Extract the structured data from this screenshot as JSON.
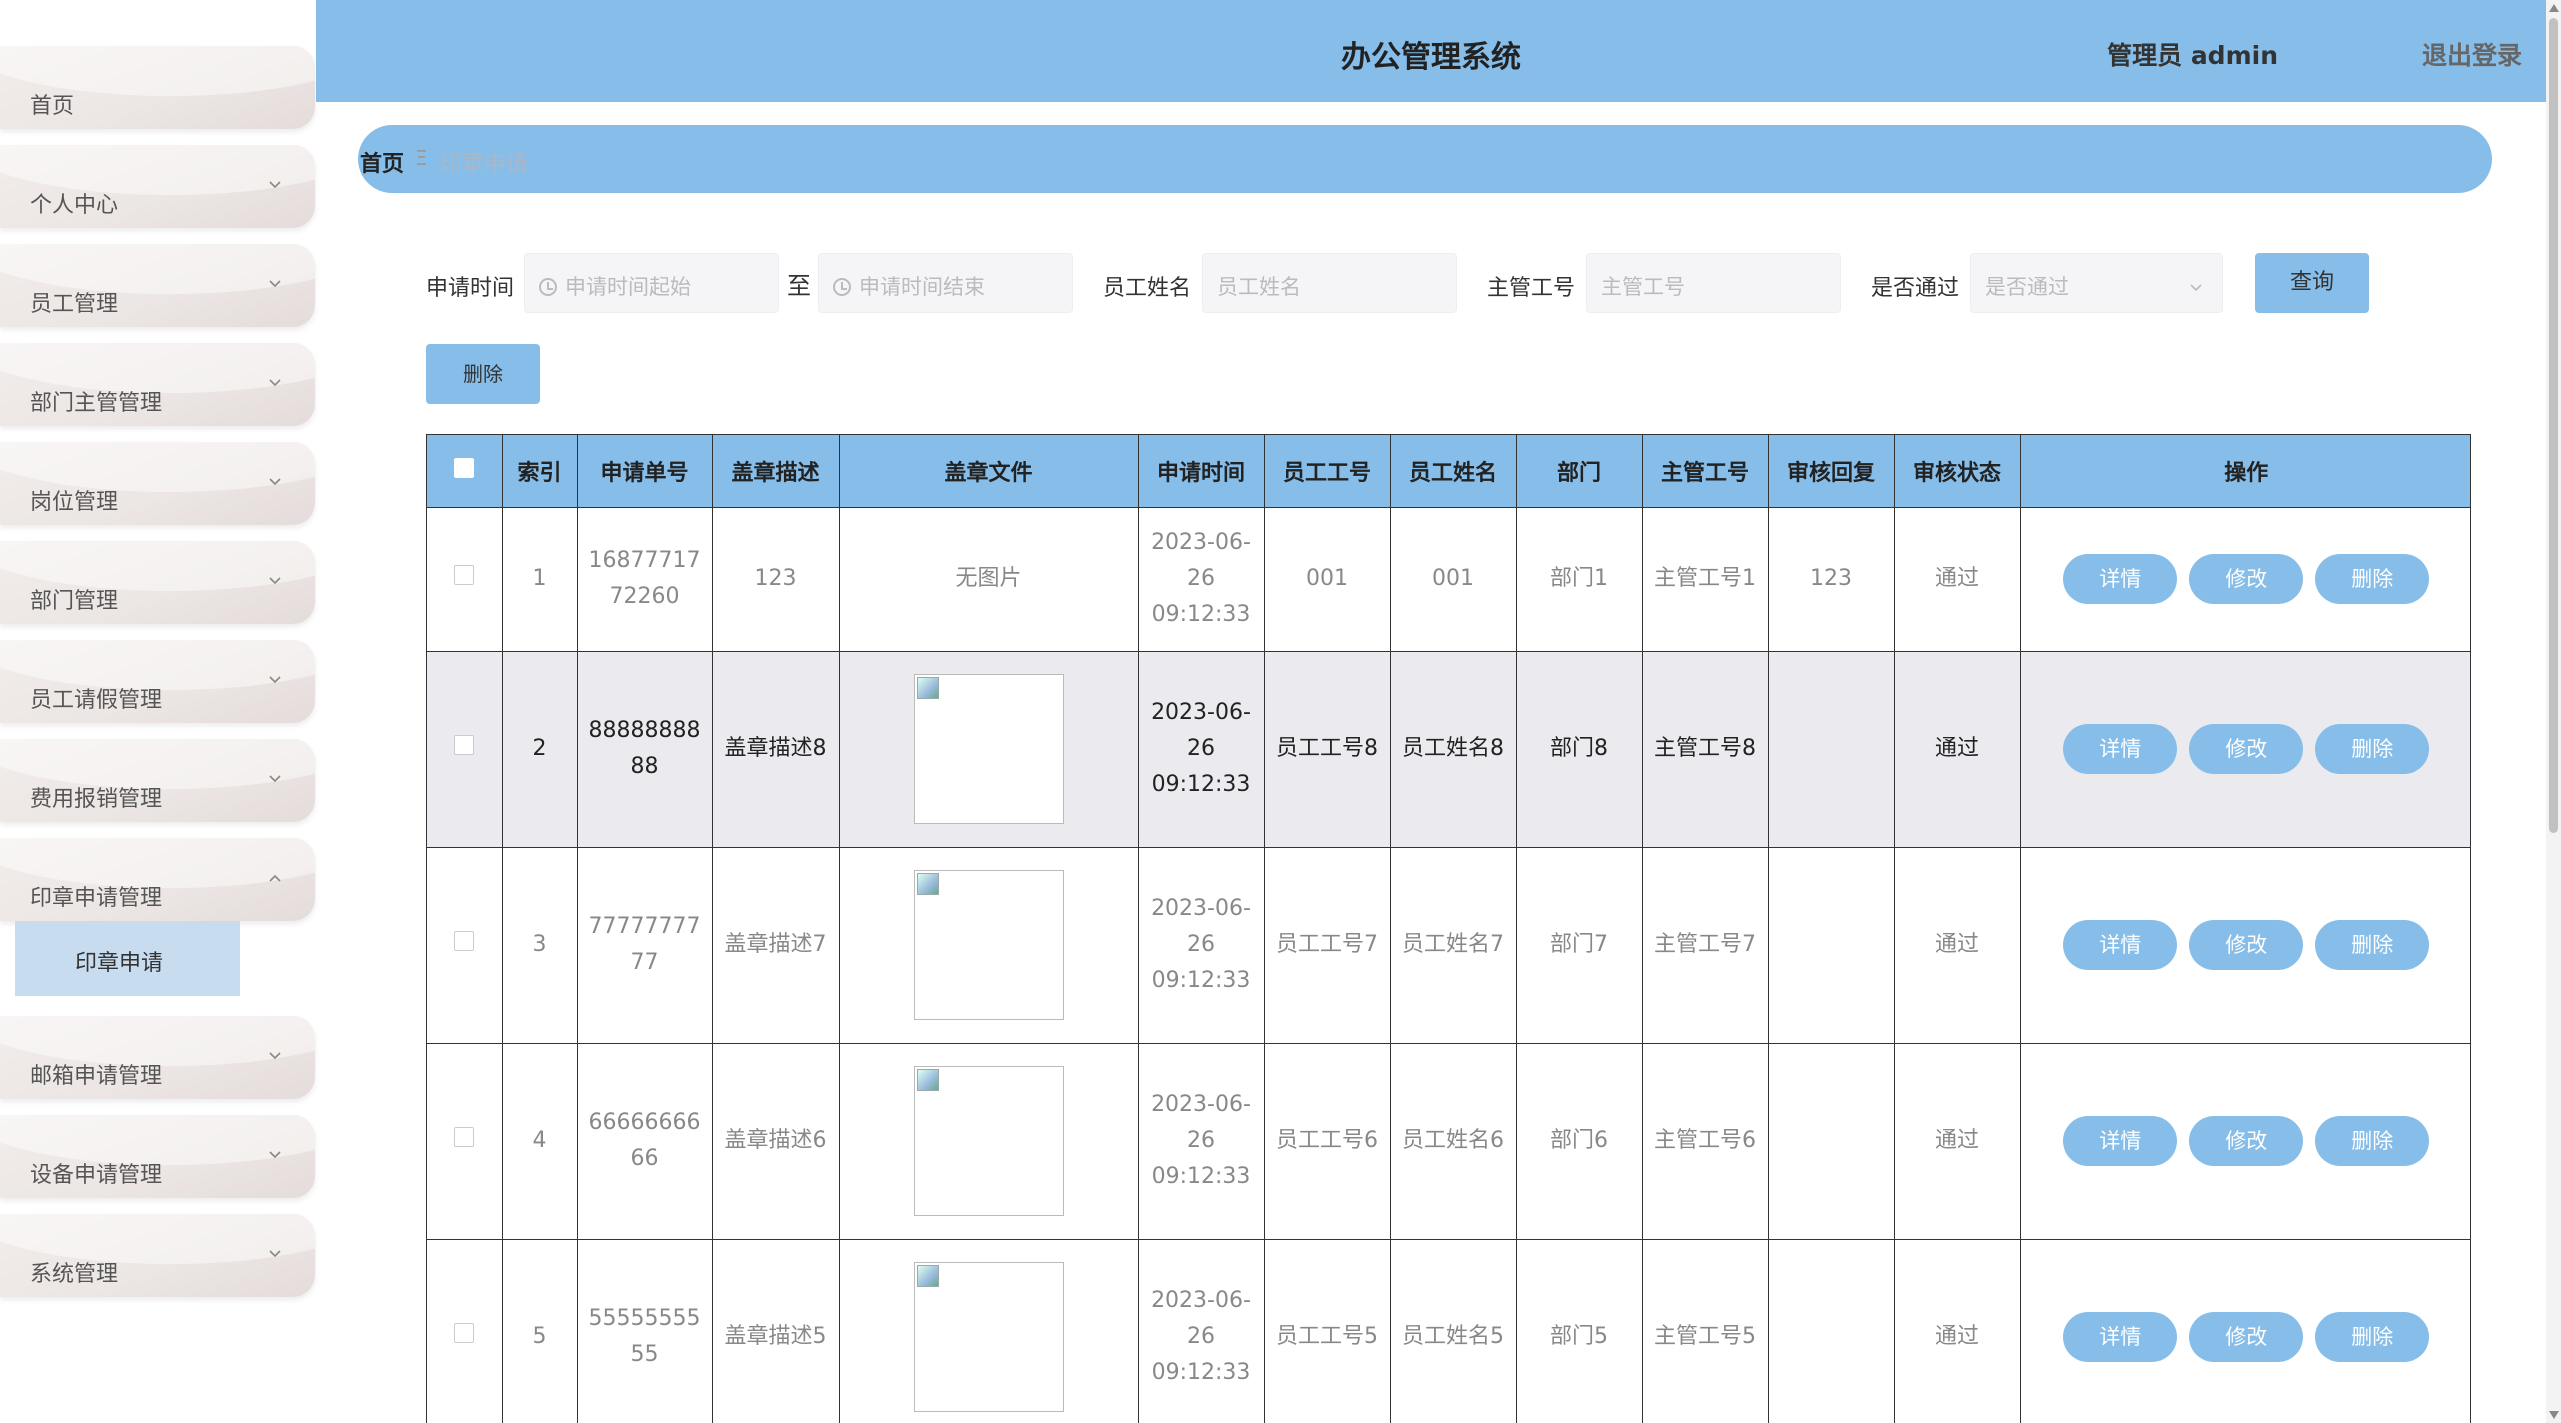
{
  "header": {
    "title": "办公管理系统",
    "user": "管理员 admin",
    "logout": "退出登录"
  },
  "sidebar": {
    "items": [
      {
        "label": "首页",
        "chevron": ""
      },
      {
        "label": "个人中心",
        "chevron": "down"
      },
      {
        "label": "员工管理",
        "chevron": "down"
      },
      {
        "label": "部门主管管理",
        "chevron": "down"
      },
      {
        "label": "岗位管理",
        "chevron": "down"
      },
      {
        "label": "部门管理",
        "chevron": "down"
      },
      {
        "label": "员工请假管理",
        "chevron": "down"
      },
      {
        "label": "费用报销管理",
        "chevron": "down"
      },
      {
        "label": "印章申请管理",
        "chevron": "up"
      },
      {
        "label": "邮箱申请管理",
        "chevron": "down"
      },
      {
        "label": "设备申请管理",
        "chevron": "down"
      },
      {
        "label": "系统管理",
        "chevron": "down"
      }
    ],
    "submenu_active": "印章申请"
  },
  "breadcrumb": {
    "home": "首页",
    "separator": "Ξ",
    "current": "印章申请"
  },
  "search": {
    "apply_time_label": "申请时间",
    "start_placeholder": "申请时间起始",
    "to_label": "至",
    "end_placeholder": "申请时间结束",
    "employee_name_label": "员工姓名",
    "employee_name_placeholder": "员工姓名",
    "supervisor_id_label": "主管工号",
    "supervisor_id_placeholder": "主管工号",
    "approved_label": "是否通过",
    "approved_placeholder": "是否通过",
    "query_button": "查询",
    "delete_button": "删除"
  },
  "table": {
    "headers": [
      "",
      "索引",
      "申请单号",
      "盖章描述",
      "盖章文件",
      "申请时间",
      "员工工号",
      "员工姓名",
      "部门",
      "主管工号",
      "审核回复",
      "审核状态",
      "操作"
    ],
    "rows": [
      {
        "index": "1",
        "order_no": "1687771772260",
        "desc": "123",
        "file": "无图片",
        "time": "2023-06-26 09:12:33",
        "emp_id": "001",
        "emp_name": "001",
        "dept": "部门1",
        "sup_id": "主管工号1",
        "reply": "123",
        "status": "通过"
      },
      {
        "index": "2",
        "order_no": "8888888888",
        "desc": "盖章描述8",
        "file": "",
        "time": "2023-06-26 09:12:33",
        "emp_id": "员工工号8",
        "emp_name": "员工姓名8",
        "dept": "部门8",
        "sup_id": "主管工号8",
        "reply": "",
        "status": "通过"
      },
      {
        "index": "3",
        "order_no": "7777777777",
        "desc": "盖章描述7",
        "file": "",
        "time": "2023-06-26 09:12:33",
        "emp_id": "员工工号7",
        "emp_name": "员工姓名7",
        "dept": "部门7",
        "sup_id": "主管工号7",
        "reply": "",
        "status": "通过"
      },
      {
        "index": "4",
        "order_no": "6666666666",
        "desc": "盖章描述6",
        "file": "",
        "time": "2023-06-26 09:12:33",
        "emp_id": "员工工号6",
        "emp_name": "员工姓名6",
        "dept": "部门6",
        "sup_id": "主管工号6",
        "reply": "",
        "status": "通过"
      },
      {
        "index": "5",
        "order_no": "5555555555",
        "desc": "盖章描述5",
        "file": "",
        "time": "2023-06-26 09:12:33",
        "emp_id": "员工工号5",
        "emp_name": "员工姓名5",
        "dept": "部门5",
        "sup_id": "主管工号5",
        "reply": "",
        "status": "通过"
      }
    ],
    "actions": {
      "detail": "详情",
      "edit": "修改",
      "delete": "删除"
    }
  },
  "colors": {
    "accent": "#86bde9",
    "row_highlight": "#ebebef"
  }
}
